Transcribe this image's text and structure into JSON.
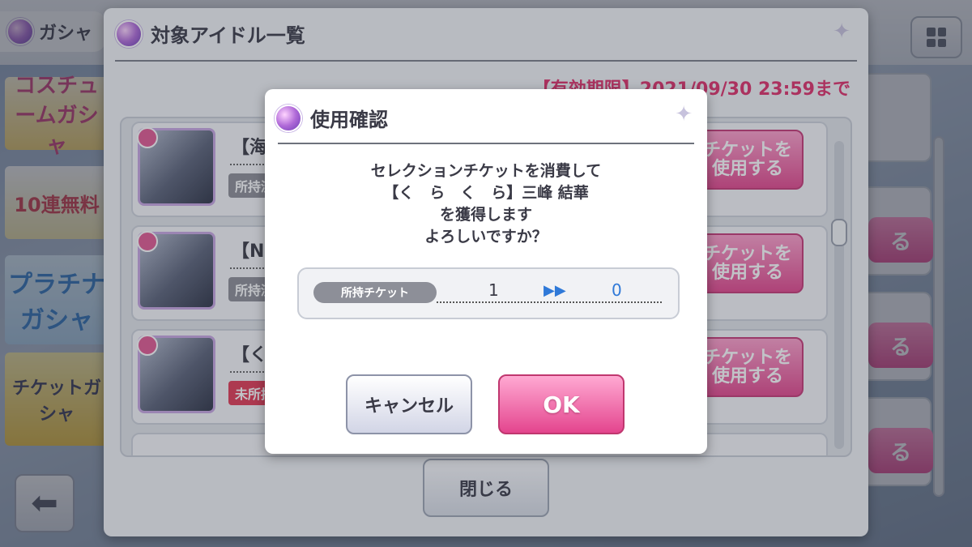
{
  "background": {
    "gacha_tab_label": "ガシャ",
    "banners": [
      "コスチュームガシャ",
      "10連無料",
      "プラチナガシャ",
      "チケットガシャ"
    ],
    "side_button_label": "る"
  },
  "list_dialog": {
    "title": "対象アイドル一覧",
    "period": "【有効期限】2021/09/30 23:59まで",
    "rows": [
      {
        "name": "【海",
        "status": "所持済",
        "button": "チケットを\n使用する"
      },
      {
        "name": "【N",
        "status": "所持済",
        "button": "チケットを\n使用する"
      },
      {
        "name": "【く",
        "status": "未所持",
        "button": "チケットを\n使用する"
      }
    ],
    "close_label": "閉じる"
  },
  "confirm_dialog": {
    "title": "使用確認",
    "message_lines": [
      "セレクションチケットを消費して",
      "【く　ら　く　ら】三峰 結華",
      "を獲得します",
      "よろしいですか？"
    ],
    "ticket_label": "所持チケット",
    "ticket_from": "1",
    "ticket_to": "0",
    "cancel_label": "キャンセル",
    "ok_label": "OK"
  },
  "colors": {
    "accent_pink": "#e4458e",
    "period_red": "#e0306a",
    "ticket_blue": "#2f79d8"
  },
  "icons": [
    "orb-icon",
    "sparkle-icon",
    "grid-menu-icon",
    "back-arrow-icon",
    "double-arrow-icon"
  ]
}
